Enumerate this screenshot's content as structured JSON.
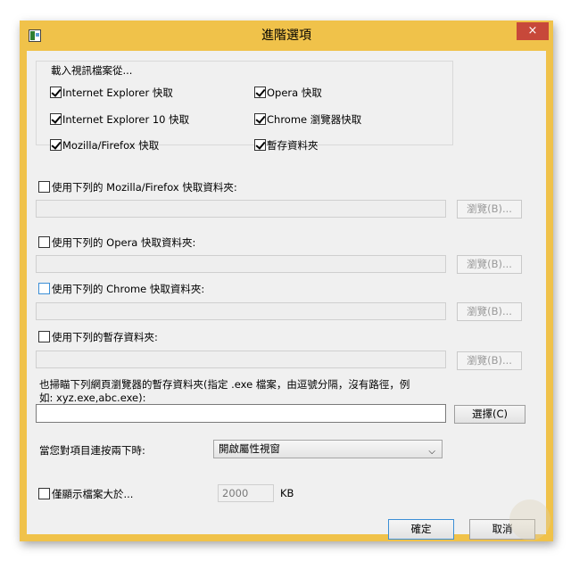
{
  "window": {
    "title": "進階選項",
    "close_label": "×"
  },
  "load_from": {
    "group_title": "載入視訊檔案從...",
    "options": [
      {
        "label": "Internet Explorer 快取",
        "checked": true
      },
      {
        "label": "Opera 快取",
        "checked": true
      },
      {
        "label": "Internet Explorer 10 快取",
        "checked": true
      },
      {
        "label": "Chrome 瀏覽器快取",
        "checked": true
      },
      {
        "label": "Mozilla/Firefox 快取",
        "checked": true
      },
      {
        "label": "暫存資料夾",
        "checked": true
      }
    ]
  },
  "custom_folders": [
    {
      "label": "使用下列的 Mozilla/Firefox 快取資料夾:",
      "checked": false,
      "value": "",
      "browse_label": "瀏覽(B)..."
    },
    {
      "label": "使用下列的 Opera 快取資料夾:",
      "checked": false,
      "value": "",
      "browse_label": "瀏覽(B)..."
    },
    {
      "label": "使用下列的 Chrome 快取資料夾:",
      "checked": false,
      "value": "",
      "browse_label": "瀏覽(B)..."
    },
    {
      "label": "使用下列的暫存資料夾:",
      "checked": false,
      "value": "",
      "browse_label": "瀏覽(B)..."
    }
  ],
  "scan_browsers": {
    "description_line1": "也掃瞄下列網頁瀏覽器的暫存資料夾(指定 .exe 檔案，由逗號分隔，沒有路徑，例",
    "description_line2": "如: xyz.exe,abc.exe):",
    "value": "",
    "select_label": "選擇(C)"
  },
  "double_click": {
    "label": "當您對項目連按兩下時:",
    "selected": "開啟屬性視窗"
  },
  "min_size": {
    "label": "僅顯示檔案大於...",
    "checked": false,
    "value": "2000",
    "unit": "KB"
  },
  "footer": {
    "ok_label": "確定",
    "cancel_label": "取消"
  },
  "colors": {
    "title_bar": "#f0c24a",
    "close_button": "#c7483a",
    "dialog_background": "#f0f0f0"
  }
}
